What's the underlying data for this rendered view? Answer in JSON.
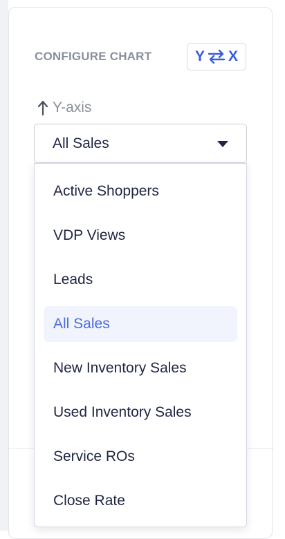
{
  "config": {
    "title": "CONFIGURE CHART",
    "swap_button": {
      "y_label": "Y",
      "x_label": "X",
      "icon": "swap-arrows-icon"
    }
  },
  "y_axis": {
    "label": "Y-axis",
    "icon": "arrow-up-icon",
    "selected_value": "All Sales",
    "options": [
      {
        "label": "Active Shoppers",
        "selected": false
      },
      {
        "label": "VDP Views",
        "selected": false
      },
      {
        "label": "Leads",
        "selected": false
      },
      {
        "label": "All Sales",
        "selected": true
      },
      {
        "label": "New Inventory Sales",
        "selected": false
      },
      {
        "label": "Used Inventory Sales",
        "selected": false
      },
      {
        "label": "Service ROs",
        "selected": false
      },
      {
        "label": "Close Rate",
        "selected": false
      }
    ]
  },
  "colors": {
    "accent": "#3a5bd9",
    "selected_bg": "#f1f4fd",
    "text": "#1f2642",
    "muted": "#8a8f9c"
  }
}
